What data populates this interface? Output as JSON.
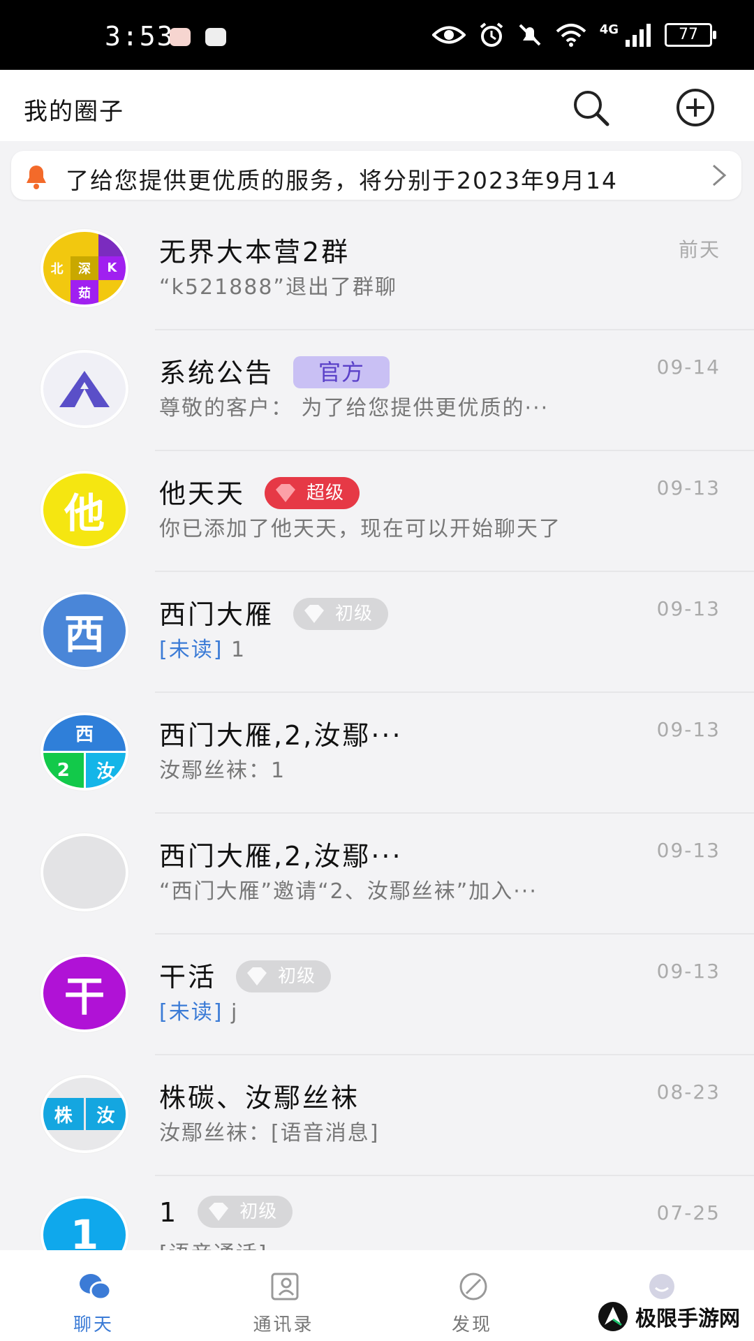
{
  "status_bar": {
    "time": "3:53",
    "network": "4G",
    "battery": "77"
  },
  "header": {
    "title": "我的圈子"
  },
  "notice": {
    "text": "了给您提供更优质的服务，将分别于2023年9月14"
  },
  "chats": [
    {
      "name": "无界大本营2群",
      "message": "“k521888”退出了群聊",
      "time": "前天",
      "avatar": {
        "type": "grid",
        "cells": [
          "",
          "",
          "北",
          "深",
          "K",
          "茹"
        ]
      }
    },
    {
      "name": "系统公告",
      "badge": {
        "kind": "official",
        "label": "官方"
      },
      "message": "尊敬的客户：  为了给您提供更优质的···",
      "time": "09-14",
      "avatar": {
        "type": "triangle"
      }
    },
    {
      "name": "他天天",
      "badge": {
        "kind": "super",
        "label": "超级"
      },
      "message": "你已添加了他天天，现在可以开始聊天了",
      "time": "09-13",
      "avatar": {
        "type": "char",
        "text": "他",
        "color": "#f5e611"
      }
    },
    {
      "name": "西门大雁",
      "badge": {
        "kind": "junior",
        "label": "初级"
      },
      "unread": "[未读]",
      "message": "1",
      "time": "09-13",
      "avatar": {
        "type": "char",
        "text": "西",
        "color": "#4a86d8"
      }
    },
    {
      "name": "西门大雁,2,汝鄢···",
      "message": "汝鄢丝袜：1",
      "time": "09-13",
      "avatar": {
        "type": "grid3",
        "cells": [
          "西",
          "2",
          "汝"
        ]
      }
    },
    {
      "name": "西门大雁,2,汝鄢···",
      "message": "“西门大雁”邀请“2、汝鄢丝袜”加入···",
      "time": "09-13",
      "avatar": {
        "type": "blank"
      }
    },
    {
      "name": "干活",
      "badge": {
        "kind": "junior",
        "label": "初级"
      },
      "unread": "[未读]",
      "message": "j",
      "time": "09-13",
      "avatar": {
        "type": "char",
        "text": "干",
        "color": "#b012d6"
      }
    },
    {
      "name": "株碳、汝鄢丝袜",
      "message": "汝鄢丝袜：[语音消息]",
      "time": "08-23",
      "avatar": {
        "type": "grid2",
        "cells": [
          "株",
          "汝"
        ]
      }
    },
    {
      "name": "1",
      "badge": {
        "kind": "junior",
        "label": "初级"
      },
      "message": "[语音通话]",
      "time": "07-25",
      "avatar": {
        "type": "char",
        "text": "1",
        "color": "#0fa8ec"
      }
    }
  ],
  "tabs": [
    {
      "label": "聊天",
      "icon": "chat-bubbles-icon",
      "active": true
    },
    {
      "label": "通讯录",
      "icon": "contacts-icon",
      "active": false
    },
    {
      "label": "发现",
      "icon": "compass-icon",
      "active": false
    },
    {
      "label": "",
      "icon": "profile-icon",
      "active": false
    }
  ],
  "watermark": {
    "text": "极限手游网"
  },
  "colors": {
    "accent": "#3b7bd6",
    "official": "#c9c0f4",
    "super": "#e63946",
    "junior": "#d7d7d9"
  }
}
